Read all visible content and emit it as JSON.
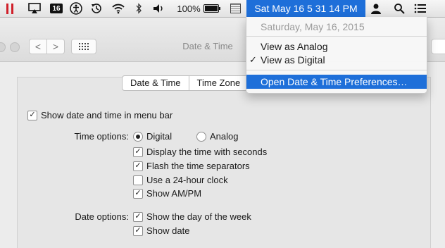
{
  "menubar": {
    "calendar_day": "16",
    "battery_percent": "100%",
    "battery_level": 1.0,
    "clock_text": "Sat May 16  5 31 14 PM"
  },
  "window": {
    "title": "Date & Time",
    "back_glyph": "<",
    "forward_glyph": ">",
    "tabs": [
      "Date & Time",
      "Time Zone"
    ]
  },
  "clock_prefs": {
    "show_in_menubar": {
      "label": "Show date and time in menu bar",
      "checked": true
    },
    "time_options_label": "Time options:",
    "digital_label": "Digital",
    "analog_label": "Analog",
    "selected_mode": "Digital",
    "time_checks": [
      {
        "label": "Display the time with seconds",
        "checked": true
      },
      {
        "label": "Flash the time separators",
        "checked": true
      },
      {
        "label": "Use a 24-hour clock",
        "checked": false
      },
      {
        "label": "Show AM/PM",
        "checked": true
      }
    ],
    "date_options_label": "Date options:",
    "date_checks": [
      {
        "label": "Show the day of the week",
        "checked": true
      },
      {
        "label": "Show date",
        "checked": true
      }
    ]
  },
  "clock_menu": {
    "date_header": "Saturday, May 16, 2015",
    "view_analog": "View as Analog",
    "view_digital": "View as Digital",
    "checked_glyph": "✓",
    "open_prefs": "Open Date & Time Preferences…"
  },
  "colors": {
    "accent": "#1e6fd9",
    "pause_red": "#d0202a"
  }
}
